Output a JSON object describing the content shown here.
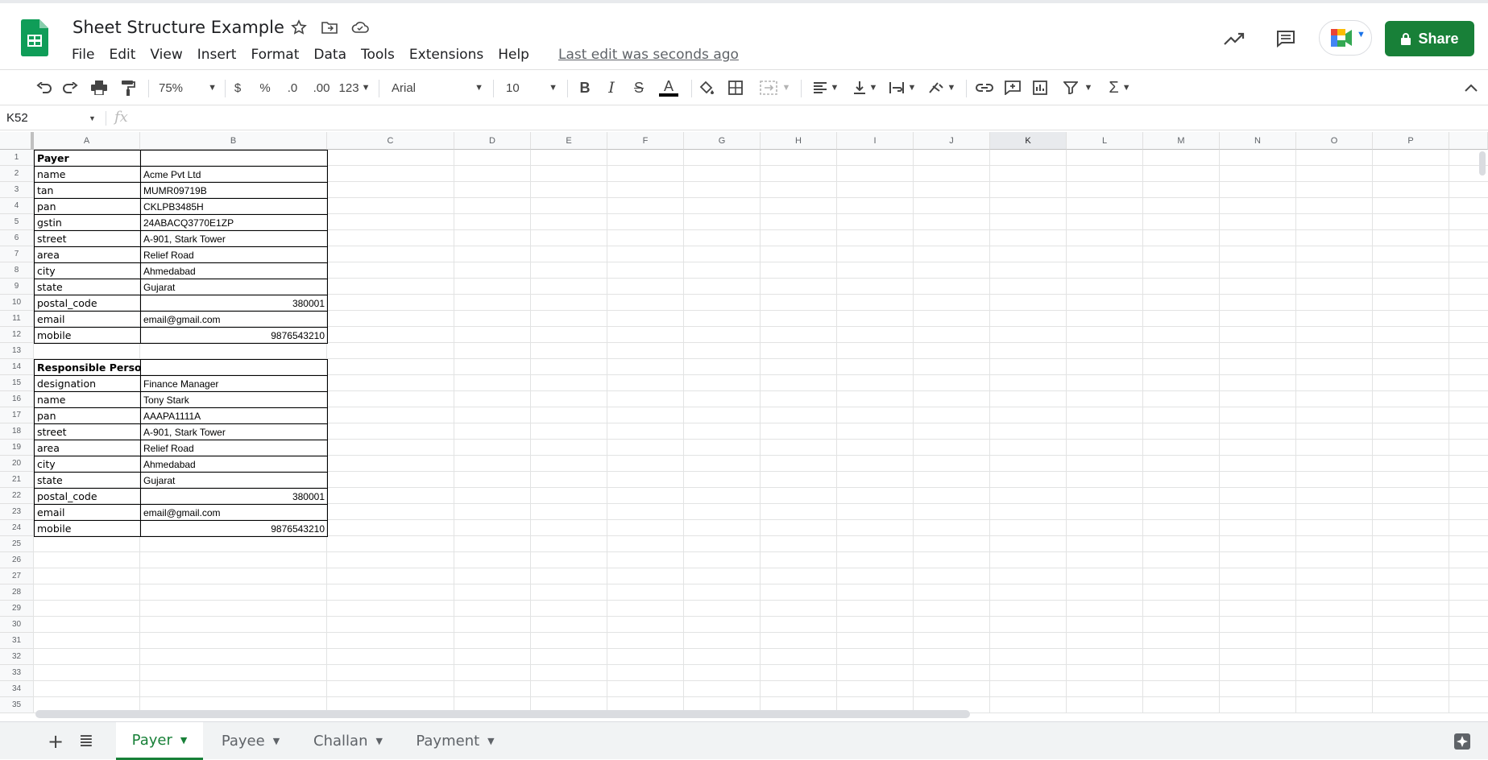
{
  "app": {
    "doc_title": "Sheet Structure Example",
    "menu": [
      "File",
      "Edit",
      "View",
      "Insert",
      "Format",
      "Data",
      "Tools",
      "Extensions",
      "Help"
    ],
    "last_edit": "Last edit was seconds ago",
    "share_label": "Share",
    "brand_color": "#188038"
  },
  "toolbar": {
    "zoom": "75%",
    "currency": "$",
    "percent": "%",
    "dec_decrease": ".0",
    "dec_increase": ".00",
    "format_more": "123",
    "font": "Arial",
    "font_size": "10"
  },
  "formula_bar": {
    "name_box": "K52",
    "fx_label": "fx"
  },
  "columns": [
    "A",
    "B",
    "C",
    "D",
    "E",
    "F",
    "G",
    "H",
    "I",
    "J",
    "K",
    "L",
    "M",
    "N",
    "O",
    "P"
  ],
  "selected_column": "K",
  "rows": [
    "1",
    "2",
    "3",
    "4",
    "5",
    "6",
    "7",
    "8",
    "9",
    "10",
    "11",
    "12",
    "13",
    "14",
    "15",
    "16",
    "17",
    "18",
    "19",
    "20",
    "21",
    "22",
    "23",
    "24",
    "25",
    "26",
    "27",
    "28",
    "29",
    "30",
    "31",
    "32",
    "33",
    "34",
    "35"
  ],
  "payer": {
    "header": "Payer",
    "rows": [
      {
        "key": "name",
        "value": "Acme Pvt Ltd"
      },
      {
        "key": "tan",
        "value": "MUMR09719B"
      },
      {
        "key": "pan",
        "value": "CKLPB3485H"
      },
      {
        "key": "gstin",
        "value": "24ABACQ3770E1ZP"
      },
      {
        "key": "street",
        "value": "A-901, Stark Tower"
      },
      {
        "key": "area",
        "value": "Relief Road"
      },
      {
        "key": "city",
        "value": "Ahmedabad"
      },
      {
        "key": "state",
        "value": "Gujarat"
      },
      {
        "key": "postal_code",
        "value": "380001"
      },
      {
        "key": "email",
        "value": "email@gmail.com"
      },
      {
        "key": "mobile",
        "value": "9876543210"
      }
    ]
  },
  "responsible": {
    "header": "Responsible Person",
    "rows": [
      {
        "key": "designation",
        "value": "Finance Manager"
      },
      {
        "key": "name",
        "value": "Tony Stark"
      },
      {
        "key": "pan",
        "value": "AAAPA1111A"
      },
      {
        "key": "street",
        "value": "A-901, Stark Tower"
      },
      {
        "key": "area",
        "value": "Relief Road"
      },
      {
        "key": "city",
        "value": "Ahmedabad"
      },
      {
        "key": "state",
        "value": "Gujarat"
      },
      {
        "key": "postal_code",
        "value": "380001"
      },
      {
        "key": "email",
        "value": "email@gmail.com"
      },
      {
        "key": "mobile",
        "value": "9876543210"
      }
    ]
  },
  "sheet_tabs": {
    "add_icon": "+",
    "list_icon": "≣",
    "tabs": [
      "Payer",
      "Payee",
      "Challan",
      "Payment"
    ],
    "active": "Payer"
  }
}
